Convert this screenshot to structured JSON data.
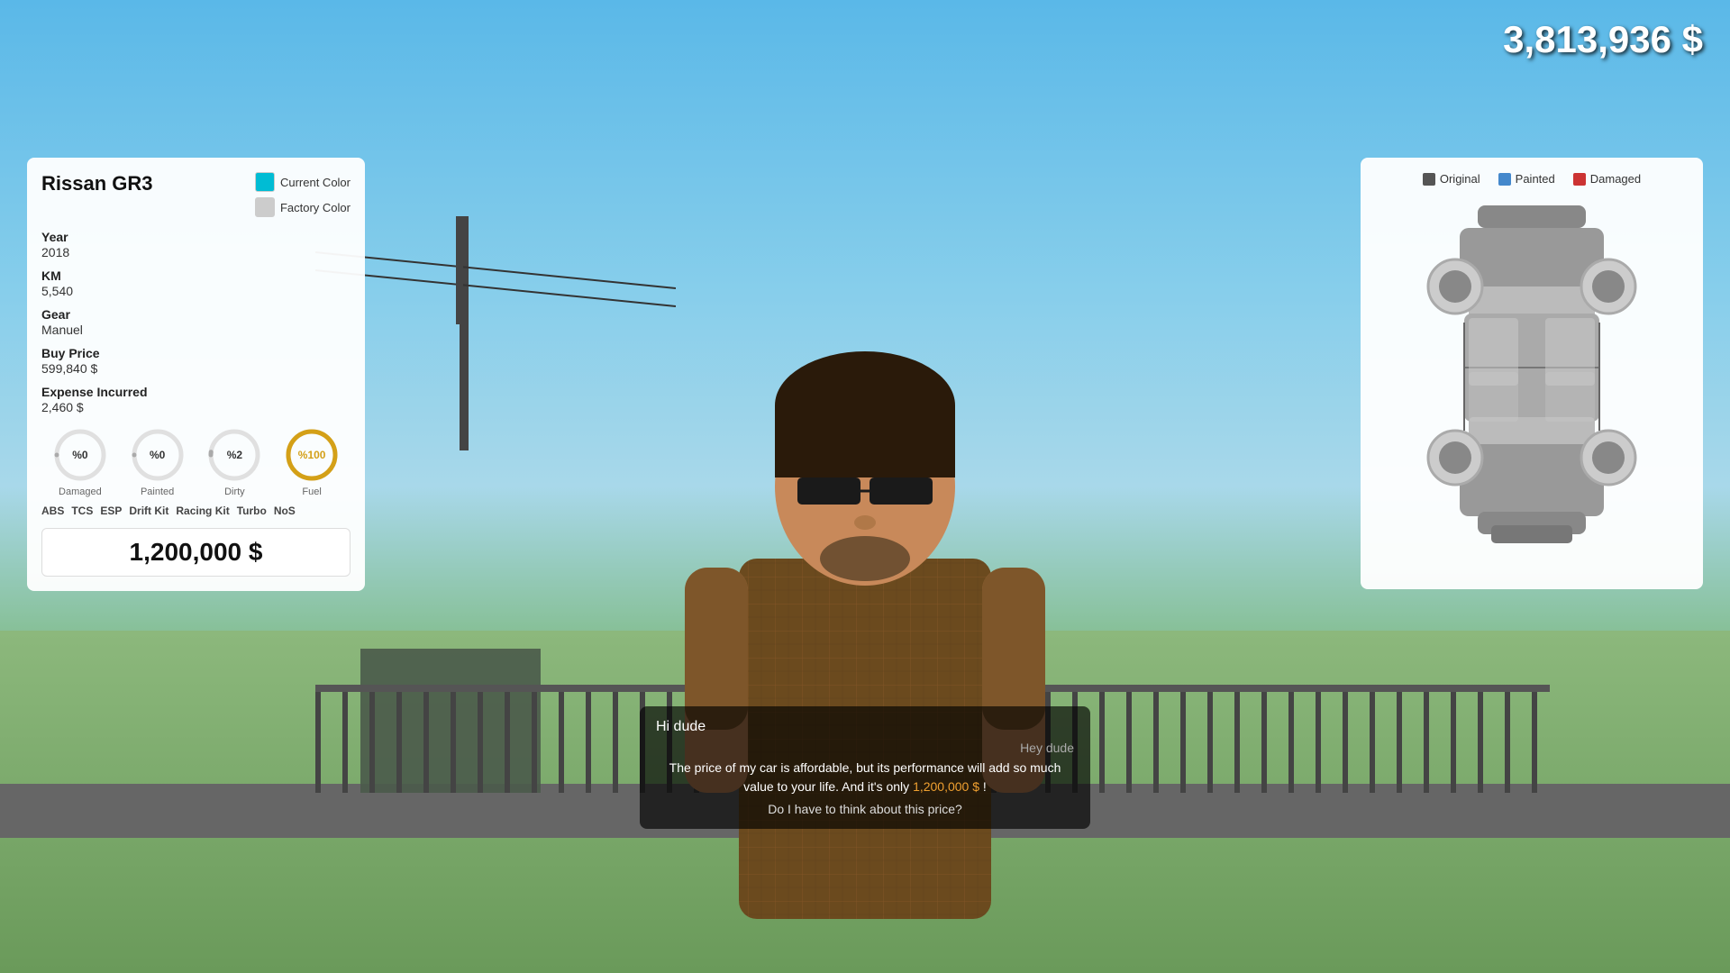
{
  "hud": {
    "money": "3,813,936 $"
  },
  "car_info": {
    "title": "Rissan GR3",
    "current_color_label": "Current Color",
    "factory_color_label": "Factory Color",
    "current_color_hex": "#00bcd4",
    "factory_color_hex": "#cccccc",
    "year_label": "Year",
    "year_value": "2018",
    "km_label": "KM",
    "km_value": "5,540",
    "gear_label": "Gear",
    "gear_value": "Manuel",
    "buy_price_label": "Buy Price",
    "buy_price_value": "599,840 $",
    "expense_label": "Expense Incurred",
    "expense_value": "2,460 $",
    "gauges": [
      {
        "id": "damaged",
        "label": "Damaged",
        "value": 0,
        "display": "%0",
        "color": "#aaaaaa",
        "percent": 0
      },
      {
        "id": "painted",
        "label": "Painted",
        "value": 0,
        "display": "%0",
        "color": "#aaaaaa",
        "percent": 0
      },
      {
        "id": "dirty",
        "label": "Dirty",
        "value": 2,
        "display": "%2",
        "color": "#aaaaaa",
        "percent": 2
      },
      {
        "id": "fuel",
        "label": "Fuel",
        "value": 100,
        "display": "%100",
        "color": "#d4a017",
        "percent": 100
      }
    ],
    "equipment": [
      "ABS",
      "TCS",
      "ESP",
      "Drift Kit",
      "Racing Kit",
      "Turbo",
      "NoS"
    ],
    "sell_price": "1,200,000 $"
  },
  "car_diagram": {
    "legend": [
      {
        "id": "original",
        "label": "Original",
        "color": "#555555"
      },
      {
        "id": "painted",
        "label": "Painted",
        "color": "#4488cc"
      },
      {
        "id": "damaged",
        "label": "Damaged",
        "color": "#cc3333"
      }
    ]
  },
  "dialogue": {
    "player_text": "Hi dude",
    "npc_name": "Hey dude",
    "main_text": "The price of my car is affordable, but its performance will add so much value to your life. And it's only",
    "price_highlight": "1,200,000 $",
    "price_suffix": "!",
    "question": "Do I have to think about this price?"
  }
}
